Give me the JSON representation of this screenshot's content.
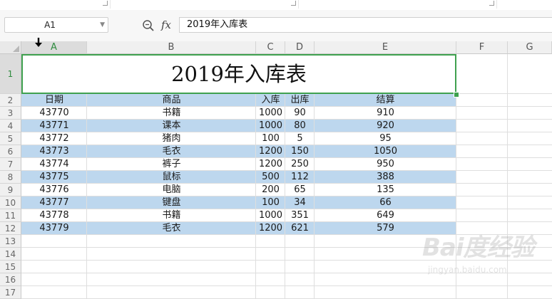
{
  "name_box": {
    "value": "A1"
  },
  "formula_bar": {
    "fx_label": "fx",
    "content": "2019年入库表"
  },
  "columns": [
    {
      "label": "A",
      "selected": true
    },
    {
      "label": "B",
      "selected": false
    },
    {
      "label": "C",
      "selected": false
    },
    {
      "label": "D",
      "selected": false
    },
    {
      "label": "E",
      "selected": false
    },
    {
      "label": "F",
      "selected": false
    },
    {
      "label": "G",
      "selected": false
    }
  ],
  "rows": [
    "1",
    "2",
    "3",
    "4",
    "5",
    "6",
    "7",
    "8",
    "9",
    "10",
    "11",
    "12",
    "13",
    "14",
    "15",
    "16",
    "17"
  ],
  "sheet": {
    "title": "2019年入库表",
    "headers": [
      "日期",
      "商品",
      "入库",
      "出库",
      "结算"
    ],
    "records": [
      [
        "43770",
        "书籍",
        "1000",
        "90",
        "910"
      ],
      [
        "43771",
        "课本",
        "1000",
        "80",
        "920"
      ],
      [
        "43772",
        "猪肉",
        "100",
        "5",
        "95"
      ],
      [
        "43773",
        "毛衣",
        "1200",
        "150",
        "1050"
      ],
      [
        "43774",
        "裤子",
        "1200",
        "250",
        "950"
      ],
      [
        "43775",
        "鼠标",
        "500",
        "112",
        "388"
      ],
      [
        "43776",
        "电脑",
        "200",
        "65",
        "135"
      ],
      [
        "43777",
        "键盘",
        "100",
        "34",
        "66"
      ],
      [
        "43778",
        "书籍",
        "1000",
        "351",
        "649"
      ],
      [
        "43779",
        "毛衣",
        "1200",
        "621",
        "579"
      ]
    ]
  },
  "colors": {
    "band": "#bdd7ee",
    "selection": "#3fa14f"
  },
  "watermark": {
    "logo": "Bai度经验",
    "url": "jingyan.baidu.com"
  }
}
